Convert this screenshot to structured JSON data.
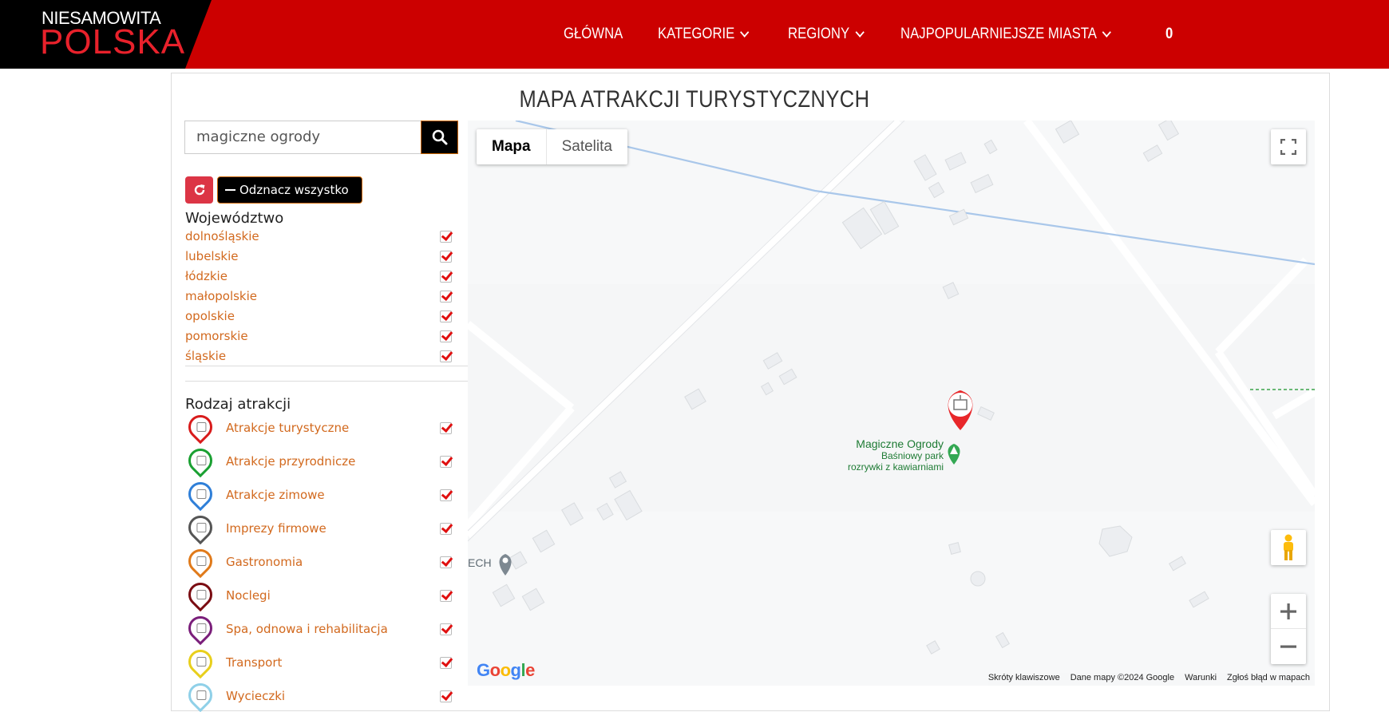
{
  "header": {
    "logo_top": "NIESAMOWITA",
    "logo_bottom": "POLSKA",
    "nav": [
      {
        "label": "GŁÓWNA",
        "dropdown": false
      },
      {
        "label": "KATEGORIE",
        "dropdown": true
      },
      {
        "label": "REGIONY",
        "dropdown": true
      },
      {
        "label": "NAJPOPULARNIEJSZE MIASTA",
        "dropdown": true
      },
      {
        "label": "0",
        "dropdown": false
      }
    ]
  },
  "page": {
    "title": "MAPA ATRAKCJI TURYSTYCZNYCH"
  },
  "sidebar": {
    "search_value": "magiczne ogrody",
    "search_icon": "search-icon",
    "reset_icon": "refresh-icon",
    "uncheck_label": "Odznacz wszystko",
    "regions_title": "Województwo",
    "regions": [
      {
        "label": "dolnośląskie",
        "checked": true
      },
      {
        "label": "lubelskie",
        "checked": true
      },
      {
        "label": "łódzkie",
        "checked": true
      },
      {
        "label": "małopolskie",
        "checked": true
      },
      {
        "label": "opolskie",
        "checked": true
      },
      {
        "label": "pomorskie",
        "checked": true
      },
      {
        "label": "śląskie",
        "checked": true
      }
    ],
    "attractions_title": "Rodzaj atrakcji",
    "attractions": [
      {
        "label": "Atrakcje turystyczne",
        "color": "#d81b1b",
        "checked": true
      },
      {
        "label": "Atrakcje przyrodnicze",
        "color": "#1aa032",
        "checked": true
      },
      {
        "label": "Atrakcje zimowe",
        "color": "#2f7fd8",
        "checked": true
      },
      {
        "label": "Imprezy firmowe",
        "color": "#555555",
        "checked": true
      },
      {
        "label": "Gastronomia",
        "color": "#e07a1a",
        "checked": true
      },
      {
        "label": "Noclegi",
        "color": "#7a0c12",
        "checked": true
      },
      {
        "label": "Spa, odnowa i rehabilitacja",
        "color": "#7a1e7a",
        "checked": true
      },
      {
        "label": "Transport",
        "color": "#e8cf1c",
        "checked": true
      },
      {
        "label": "Wycieczki",
        "color": "#8fd0e8",
        "checked": true
      }
    ]
  },
  "map": {
    "type_options": [
      "Mapa",
      "Satelita"
    ],
    "active_type": "Mapa",
    "place_name": "Magiczne Ogrody",
    "place_desc_1": "Baśniowy park",
    "place_desc_2": "rozrywki z kawiarniami",
    "side_label": "ECH",
    "google_logo": "Google",
    "footer": [
      "Skróty klawiszowe",
      "Dane mapy ©2024 Google",
      "Warunki",
      "Zgłoś błąd w mapach"
    ]
  }
}
